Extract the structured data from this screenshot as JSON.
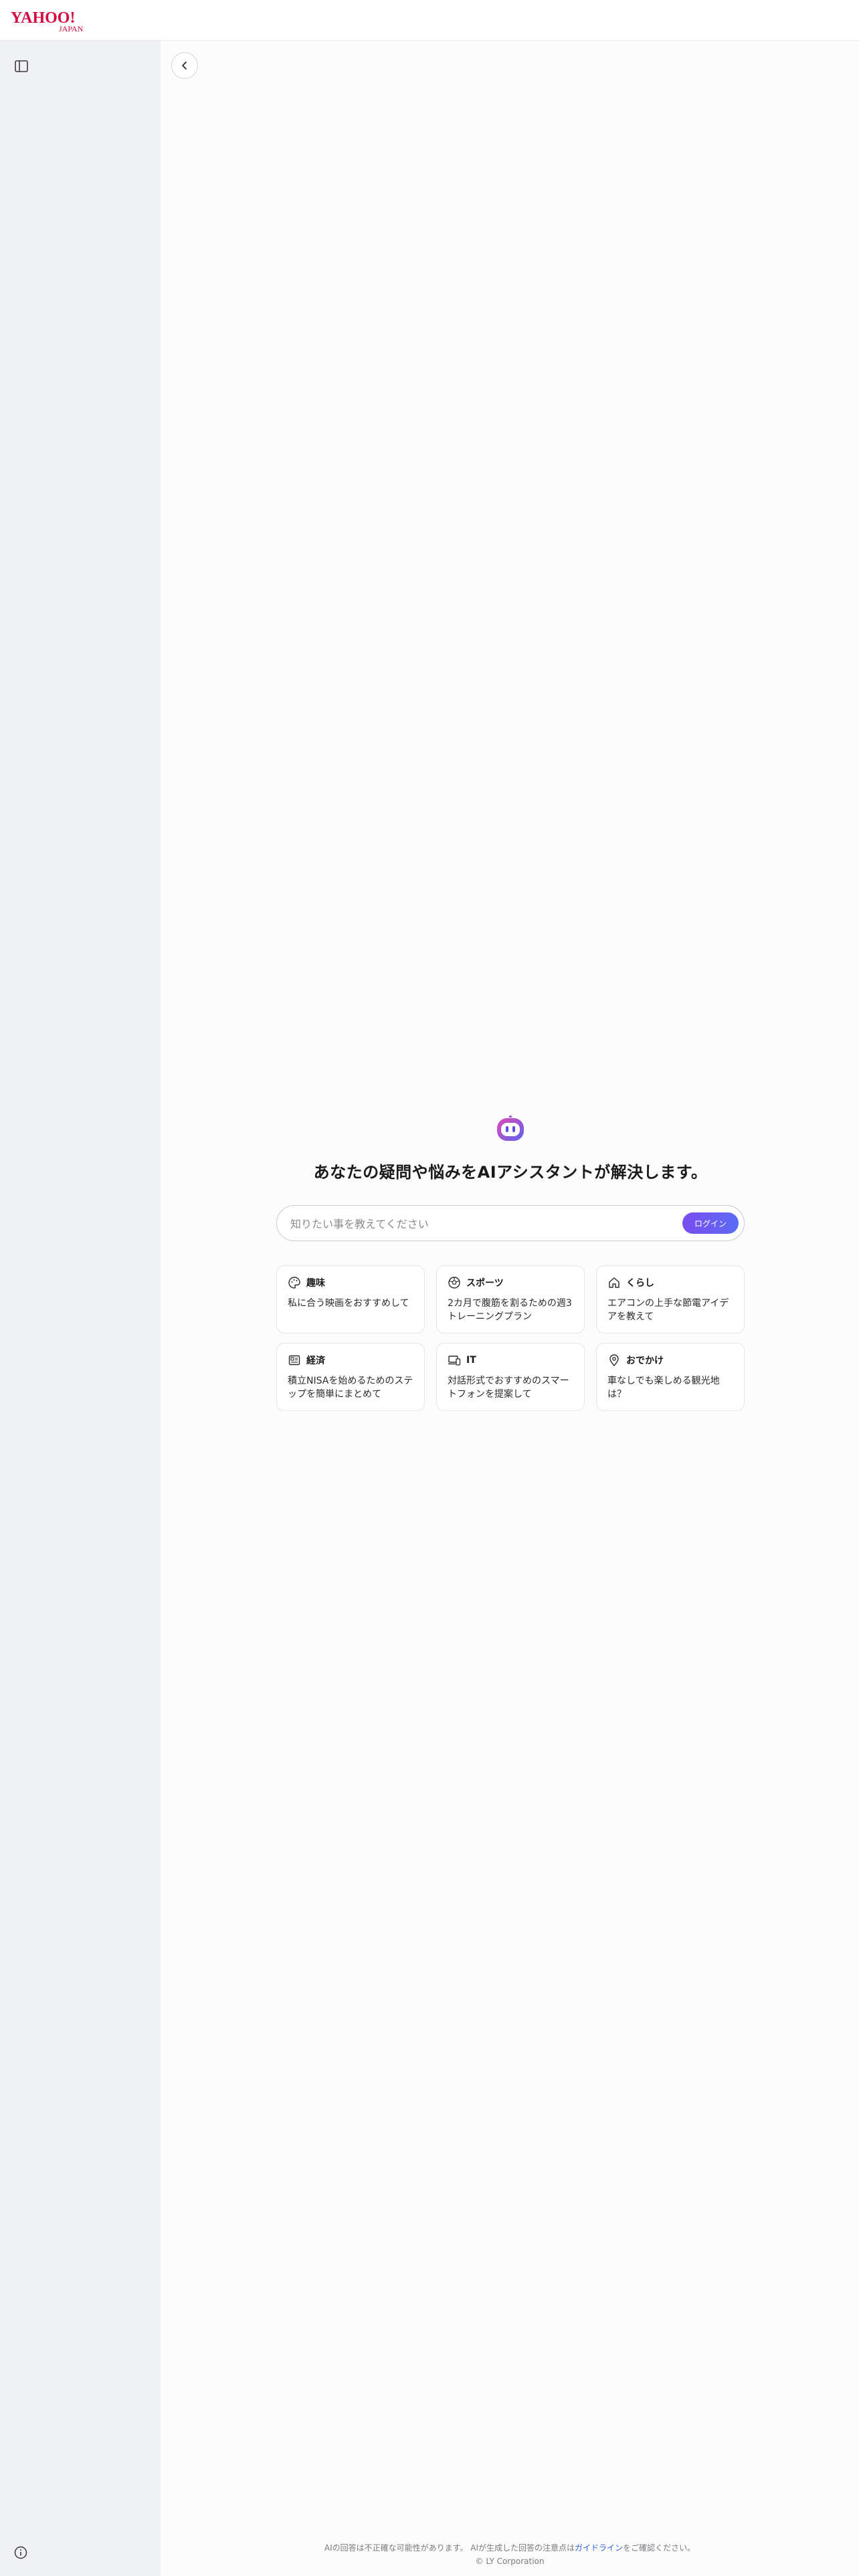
{
  "header": {
    "logo_text": "YAHOO!",
    "logo_subtext": "JAPAN"
  },
  "main": {
    "headline": "あなたの疑問や悩みをAIアシスタントが解決します。",
    "search": {
      "placeholder": "知りたい事を教えてください",
      "value": ""
    },
    "login_label": "ログイン",
    "cards": [
      {
        "icon": "palette-icon",
        "title": "趣味",
        "text": "私に合う映画をおすすめして"
      },
      {
        "icon": "ball-icon",
        "title": "スポーツ",
        "text": "2カ月で腹筋を割るための週3トレーニングプラン"
      },
      {
        "icon": "house-icon",
        "title": "くらし",
        "text": "エアコンの上手な節電アイデアを教えて"
      },
      {
        "icon": "newspaper-icon",
        "title": "経済",
        "text": "積立NISAを始めるためのステップを簡単にまとめて"
      },
      {
        "icon": "devices-icon",
        "title": "IT",
        "text": "対話形式でおすすめのスマートフォンを提案して"
      },
      {
        "icon": "map-pin-icon",
        "title": "おでかけ",
        "text": "車なしでも楽しめる観光地は？"
      }
    ]
  },
  "footer": {
    "disclaimer_prefix": "AIの回答は不正確な可能性があります。 AIが生成した回答の注意点は",
    "guideline_link": "ガイドライン",
    "disclaimer_suffix": "をご確認ください。",
    "copyright": "© LY Corporation"
  },
  "colors": {
    "accent_start": "#7a4cf0",
    "accent_end": "#5b6cf5",
    "logo_red": "#d7063e",
    "link": "#2f5fd6",
    "sidebar_bg": "#f0f1f5"
  }
}
